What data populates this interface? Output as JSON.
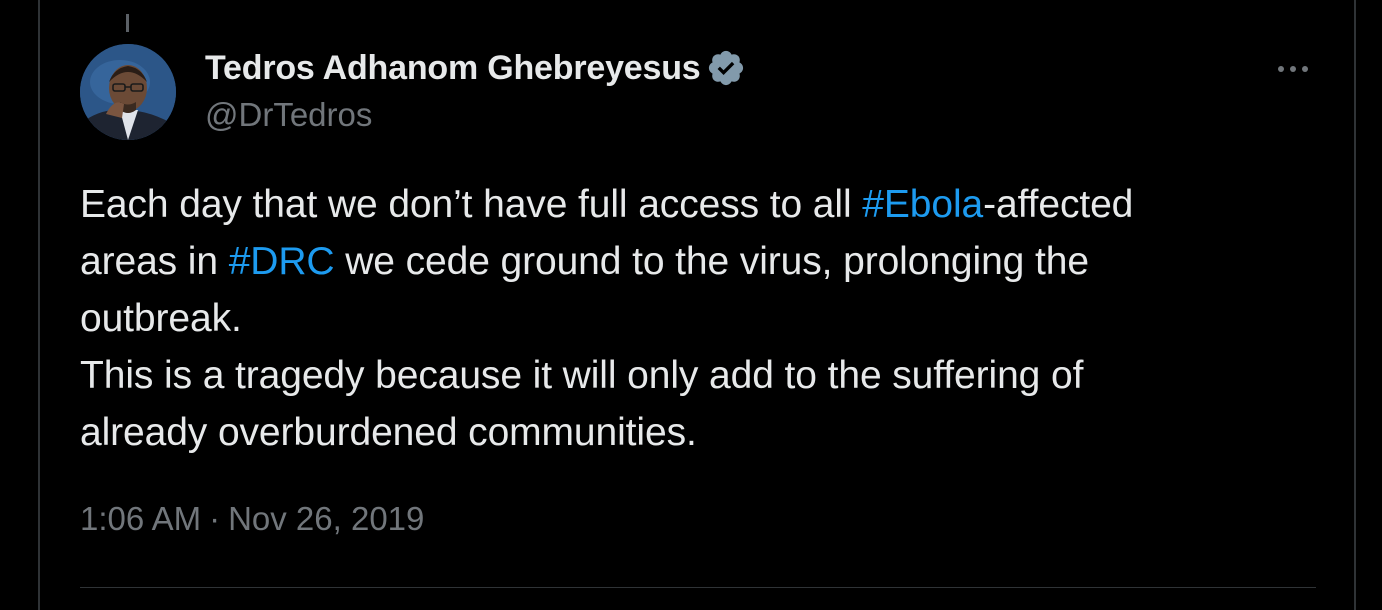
{
  "colors": {
    "background": "#000000",
    "text_primary": "#e7e9ea",
    "text_secondary": "#71767b",
    "accent_link": "#1d9bf0",
    "verified_badge": "#829aab",
    "border": "#2f3336"
  },
  "author": {
    "display_name": "Tedros Adhanom Ghebreyesus",
    "handle": "@DrTedros",
    "verified_icon": "verified-badge-icon",
    "avatar_icon": "profile-photo"
  },
  "actions": {
    "more_icon": "more-horizontal-icon"
  },
  "tweet": {
    "line1": {
      "pre": "Each day that we don’t have full access to all ",
      "hashtag": "#Ebola",
      "post": "-affected"
    },
    "line2": {
      "pre": "areas in ",
      "hashtag": "#DRC",
      "post": " we cede ground to the virus, prolonging the"
    },
    "line3": "outbreak.",
    "line4": "This is a tragedy because it will only add to the suffering of",
    "line5": "already overburdened communities."
  },
  "meta": {
    "time": "1:06 AM",
    "separator": "·",
    "date": "Nov 26, 2019"
  }
}
